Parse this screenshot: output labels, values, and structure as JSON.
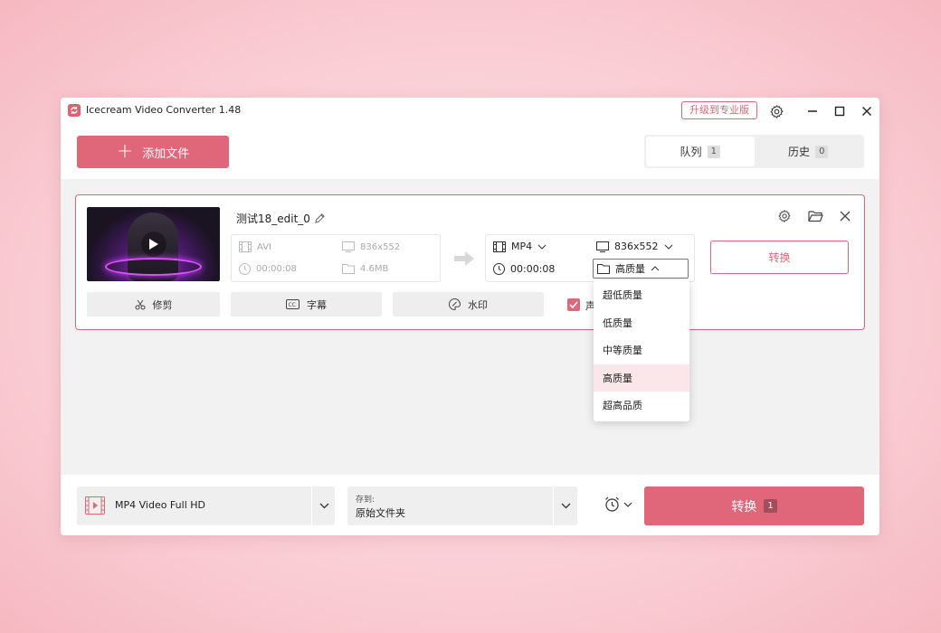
{
  "window": {
    "title": "Icecream Video Converter 1.48",
    "upgrade_label": "升级到专业版"
  },
  "header": {
    "add_file_label": "添加文件",
    "tabs": [
      {
        "label": "队列",
        "count": "1",
        "active": true
      },
      {
        "label": "历史",
        "count": "0",
        "active": false
      }
    ]
  },
  "item": {
    "file_name": "测试18_edit_0",
    "source": {
      "format": "AVI",
      "resolution": "836x552",
      "duration": "00:00:08",
      "size": "4.6MB"
    },
    "target": {
      "format": "MP4",
      "resolution": "836x552",
      "duration": "00:00:08",
      "quality": "高质量"
    },
    "convert_label": "转换",
    "tools": {
      "trim": "修剪",
      "subtitles": "字幕",
      "watermark": "水印",
      "audio": "声"
    }
  },
  "quality_dropdown": {
    "options": [
      "超低质量",
      "低质量",
      "中等质量",
      "高质量",
      "超高品质"
    ],
    "selected": "高质量"
  },
  "footer": {
    "preset": "MP4 Video Full HD",
    "save_caption": "存到:",
    "save_value": "原始文件夹",
    "convert_label": "转换",
    "convert_count": "1"
  },
  "colors": {
    "accent": "#e0667a",
    "selected_bg": "#fbe6ea"
  }
}
